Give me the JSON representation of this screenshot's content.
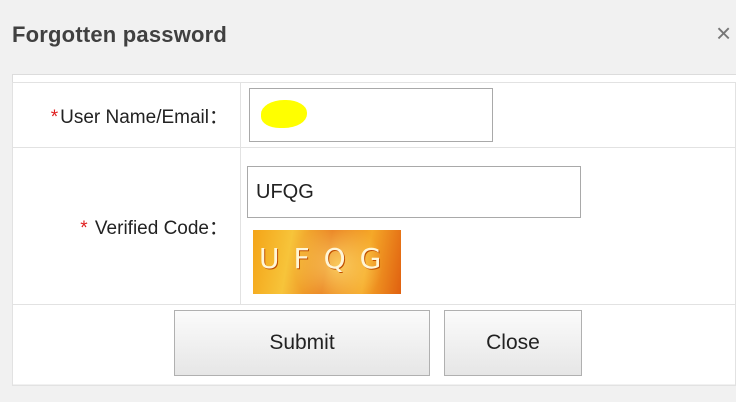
{
  "dialog": {
    "title": "Forgotten password",
    "close_glyph": "×"
  },
  "form": {
    "username": {
      "required_mark": "*",
      "label": "User Name/Email：",
      "value": "",
      "redaction_color": "#ffff00"
    },
    "verified_code": {
      "required_mark": "*",
      "label": " Verified Code：",
      "value": "UFQG",
      "captcha_text": "UFQG"
    }
  },
  "buttons": {
    "submit_label": "Submit",
    "close_label": "Close"
  },
  "colors": {
    "required": "#e02020",
    "redaction": "#ffff00",
    "captcha_base": "#f4a418"
  }
}
